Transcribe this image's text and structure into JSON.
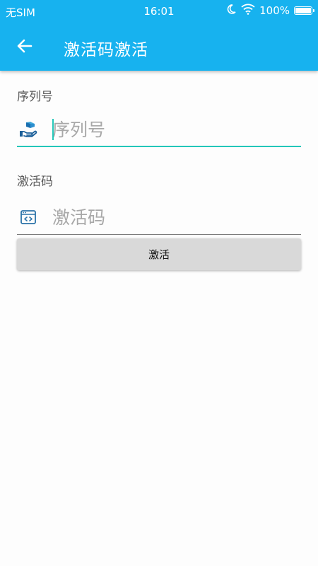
{
  "status_bar": {
    "carrier": "无SIM",
    "time": "16:01",
    "battery": "100%"
  },
  "toolbar": {
    "title": "激活码激活",
    "accent_color": "#17b2ef"
  },
  "form": {
    "serial": {
      "label": "序列号",
      "placeholder": "序列号",
      "value": ""
    },
    "code": {
      "label": "激活码",
      "placeholder": "激活码",
      "value": ""
    },
    "submit_label": "激活"
  },
  "icons": {
    "serial": "package-hand-icon",
    "code": "code-window-icon",
    "back": "arrow-left-icon"
  }
}
